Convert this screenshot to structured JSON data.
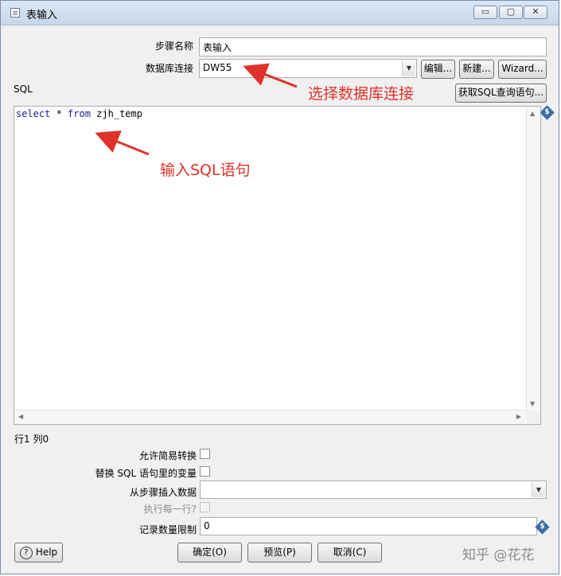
{
  "window": {
    "title": "表输入",
    "minimize": "▭",
    "maximize": "▢",
    "close": "✕"
  },
  "form": {
    "step_name_label": "步骤名称",
    "step_name_value": "表输入",
    "db_conn_label": "数据库连接",
    "db_conn_value": "DW55",
    "edit_button": "编辑...",
    "new_button": "新建...",
    "wizard_button": "Wizard...",
    "sql_label": "SQL",
    "get_sql_button": "获取SQL查询语句..."
  },
  "editor": {
    "code_keyword1": "select",
    "code_mid": " * ",
    "code_keyword2": "from",
    "code_rest": " zjh_temp",
    "position": "行1 列0"
  },
  "options": {
    "lazy_conversion_label": "允许简易转换",
    "replace_vars_label": "替换 SQL 语句里的变量",
    "insert_from_step_label": "从步骤插入数据",
    "insert_from_step_value": "",
    "execute_each_row_label": "执行每一行?",
    "limit_label": "记录数量限制",
    "limit_value": "0"
  },
  "footer": {
    "help_button": "Help",
    "ok_button": "确定(O)",
    "preview_button": "预览(P)",
    "cancel_button": "取消(C)"
  },
  "annotations": {
    "choose_db": "选择数据库连接",
    "enter_sql": "输入SQL语句",
    "color": "#e0322a"
  },
  "watermark": "知乎 @花花"
}
